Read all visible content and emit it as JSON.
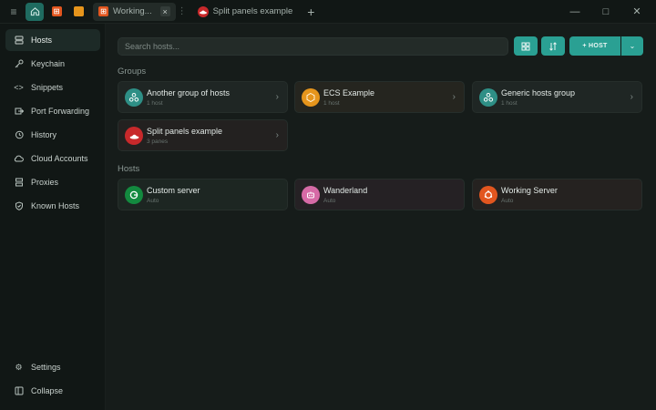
{
  "titlebar": {
    "tabs": [
      {
        "label": "Working...",
        "icon": "server-icon",
        "close": "×"
      },
      {
        "label": "Split panels example",
        "icon": "redhat-icon"
      }
    ],
    "add_tab": "+",
    "window_controls": {
      "menu": "≡",
      "minimize": "—",
      "maximize": "□",
      "close": "✕"
    }
  },
  "sidebar": {
    "items": [
      {
        "label": "Hosts",
        "icon": "hosts-icon",
        "active": true
      },
      {
        "label": "Keychain",
        "icon": "key-icon"
      },
      {
        "label": "Snippets",
        "icon": "code-icon"
      },
      {
        "label": "Port Forwarding",
        "icon": "port-forward-icon"
      },
      {
        "label": "History",
        "icon": "history-icon"
      },
      {
        "label": "Cloud Accounts",
        "icon": "cloud-icon"
      },
      {
        "label": "Proxies",
        "icon": "proxy-icon"
      },
      {
        "label": "Known Hosts",
        "icon": "shield-icon"
      }
    ],
    "bottom": [
      {
        "label": "Settings",
        "icon": "gear-icon"
      },
      {
        "label": "Collapse",
        "icon": "collapse-icon"
      }
    ]
  },
  "toolbar": {
    "search_placeholder": "Search hosts...",
    "host_button": "+ HOST"
  },
  "groups": {
    "title": "Groups",
    "items": [
      {
        "name": "Another group of hosts",
        "sub": "1 host",
        "color": "#2e8f86",
        "icon": "group-icon"
      },
      {
        "name": "ECS Example",
        "sub": "1 host",
        "color": "#e6951c",
        "icon": "ecs-icon"
      },
      {
        "name": "Generic hosts group",
        "sub": "1 host",
        "color": "#2e8f86",
        "icon": "group-icon"
      },
      {
        "name": "Split panels example",
        "sub": "3 panes",
        "color": "#c8292b",
        "icon": "redhat-icon"
      }
    ]
  },
  "hosts": {
    "title": "Hosts",
    "items": [
      {
        "name": "Custom server",
        "sub": "Auto",
        "color": "#138a3f",
        "icon": "opensuse-icon"
      },
      {
        "name": "Wanderland",
        "sub": "Auto",
        "color": "#d66aa6",
        "icon": "robot-icon"
      },
      {
        "name": "Working Server",
        "sub": "Auto",
        "color": "#e2561f",
        "icon": "ubuntu-icon"
      }
    ]
  }
}
